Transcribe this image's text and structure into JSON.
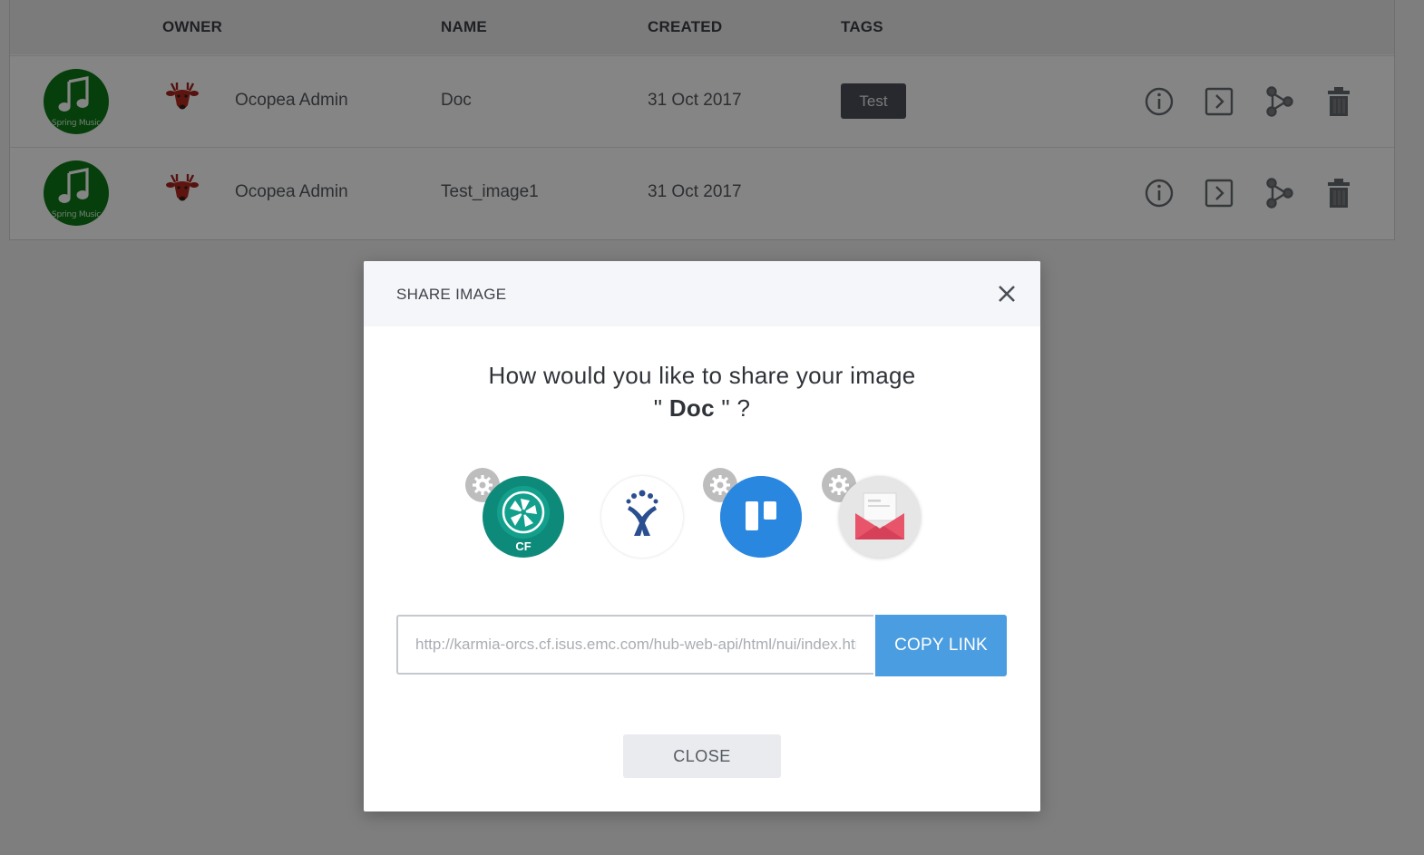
{
  "table": {
    "headers": {
      "owner": "OWNER",
      "name": "NAME",
      "created": "CREATED",
      "tags": "TAGS"
    },
    "rows": [
      {
        "thumb_text": "Spring Music",
        "owner": "Ocopea Admin",
        "name": "Doc",
        "created": "31 Oct 2017",
        "tag": "Test"
      },
      {
        "thumb_text": "Spring Music",
        "owner": "Ocopea Admin",
        "name": "Test_image1",
        "created": "31 Oct 2017",
        "tag": ""
      }
    ],
    "actions": [
      "info-icon",
      "run-icon",
      "share-icon",
      "trash-icon"
    ]
  },
  "modal": {
    "title": "SHARE IMAGE",
    "question": "How would you like to share your image",
    "doc_prefix": "\" ",
    "doc_name": "Doc",
    "doc_suffix": " \" ?",
    "services": [
      {
        "icon": "cloud-foundry-icon",
        "label": "CF",
        "has_settings": true
      },
      {
        "icon": "jira-icon",
        "has_settings": false
      },
      {
        "icon": "trello-icon",
        "has_settings": true
      },
      {
        "icon": "email-icon",
        "has_settings": true
      }
    ],
    "link_value": "http://karmia-orcs.cf.isus.emc.com/hub-web-api/html/nui/index.html",
    "copy_label": "COPY LINK",
    "close_label": "CLOSE"
  },
  "colors": {
    "accent": "#4a9de0",
    "cf_teal": "#0e8a7a",
    "trello_blue": "#2a87e0",
    "email_red": "#e8546a",
    "jira_blue": "#2a4e8f",
    "thumb_green": "#0d7a16"
  }
}
